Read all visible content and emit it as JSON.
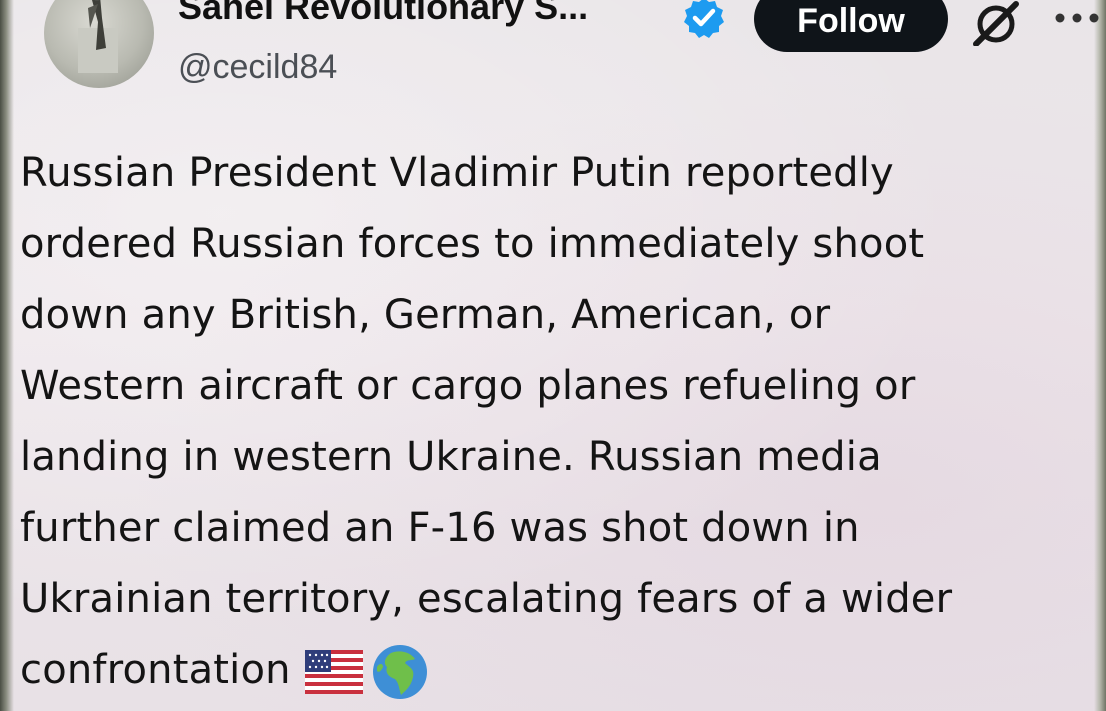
{
  "post": {
    "author": {
      "display_name": "Sahel Revolutionary S...",
      "handle": "@cecild84",
      "verified": true
    },
    "actions": {
      "follow_label": "Follow",
      "grok_icon": "grok-icon",
      "more_icon": "more-dots-icon"
    },
    "text_lines": [
      "Russian President Vladimir Putin reportedly",
      "ordered Russian forces to immediately shoot",
      "down any British, German, American, or",
      "Western aircraft or cargo planes refueling or",
      "landing in western Ukraine. Russian media",
      "further claimed an F-16 was shot down in",
      "Ukrainian territory, escalating fears of a wider",
      "confrontation"
    ],
    "emojis": [
      "us-flag-emoji",
      "globe-africa-europe-emoji"
    ]
  },
  "colors": {
    "follow_bg": "#0f1419",
    "verified_blue": "#1d9bf0",
    "text": "#141414",
    "handle": "#4b4f55"
  }
}
